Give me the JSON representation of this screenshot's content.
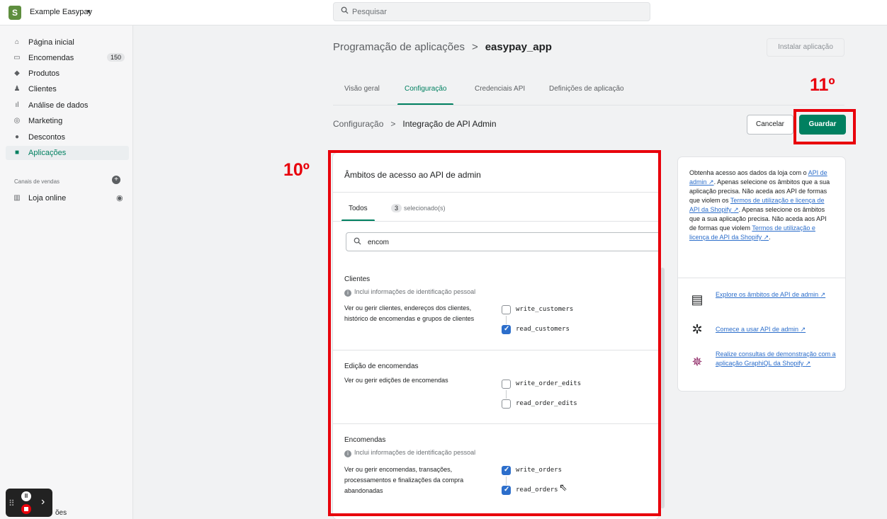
{
  "topbar": {
    "store_logo": "S",
    "store_name": "Example Easypay",
    "store_caret": "▾",
    "search_placeholder": "Pesquisar"
  },
  "sidebar": {
    "items": [
      {
        "label": "Página inicial",
        "icon": "home-icon",
        "glyph": "⌂"
      },
      {
        "label": "Encomendas",
        "icon": "orders-icon",
        "glyph": "▭",
        "badge": "150"
      },
      {
        "label": "Produtos",
        "icon": "tag-icon",
        "glyph": "◆"
      },
      {
        "label": "Clientes",
        "icon": "customers-icon",
        "glyph": "♟"
      },
      {
        "label": "Análise de dados",
        "icon": "analytics-icon",
        "glyph": "ıl"
      },
      {
        "label": "Marketing",
        "icon": "marketing-icon",
        "glyph": "◎"
      },
      {
        "label": "Descontos",
        "icon": "discount-icon",
        "glyph": "●"
      },
      {
        "label": "Aplicações",
        "icon": "apps-icon",
        "glyph": "■"
      }
    ],
    "channels_title": "Canais de vendas",
    "online_store": "Loja online"
  },
  "page": {
    "breadcrumb_parent": "Programação de aplicações",
    "breadcrumb_sep": ">",
    "breadcrumb_current": "easypay_app",
    "install_button": "Instalar aplicação",
    "tabs": [
      "Visão geral",
      "Configuração",
      "Credenciais API",
      "Definições de aplicação"
    ],
    "active_tab": "Configuração",
    "sub_breadcrumb_parent": "Configuração",
    "sub_breadcrumb_current": "Integração de API Admin",
    "cancel_button": "Cancelar",
    "save_button": "Guardar",
    "annotation_step_10": "10º",
    "annotation_step_11": "11º",
    "accent_color": "#008060",
    "annotation_color": "#e8000b"
  },
  "scopes_card": {
    "title": "Âmbitos de acesso ao API de admin",
    "tab_all": "Todos",
    "selected_count": "3",
    "selected_label": "selecionado(s)",
    "filter_value": "encom",
    "sections": [
      {
        "title": "Clientes",
        "note": "Inclui informações de identificação pessoal",
        "description": "Ver ou gerir clientes, endereços dos clientes, histórico de encomendas e grupos de clientes",
        "scopes": [
          {
            "name": "write_customers",
            "checked": false
          },
          {
            "name": "read_customers",
            "checked": true
          }
        ]
      },
      {
        "title": "Edição de encomendas",
        "note": "",
        "description": "Ver ou gerir edições de encomendas",
        "scopes": [
          {
            "name": "write_order_edits",
            "checked": false
          },
          {
            "name": "read_order_edits",
            "checked": false
          }
        ]
      },
      {
        "title": "Encomendas",
        "note": "Inclui informações de identificação pessoal",
        "description": "Ver ou gerir encomendas, transações, processamentos e finalizações da compra abandonadas",
        "scopes": [
          {
            "name": "write_orders",
            "checked": true
          },
          {
            "name": "read_orders",
            "checked": true
          }
        ]
      }
    ]
  },
  "info_card": {
    "text_1": "Obtenha acesso aos dados da loja com o ",
    "link_1": "API de admin",
    "text_2": ". Apenas selecione os âmbitos que a sua aplicação precisa. Não aceda aos API de formas que violem os ",
    "link_2": "Termos de utilização e licença de API da Shopify",
    "text_3": ". Apenas selecione os âmbitos que a sua aplicação precisa. Não aceda aos API de formas que violem ",
    "link_3": "Termos de utilização e licença de API da Shopify",
    "text_4": ".",
    "ext_glyph": "↗",
    "resources": [
      {
        "label": "Explore os âmbitos de API de admin",
        "icon": "document-icon",
        "glyph": "▤"
      },
      {
        "label": "Comece a usar API de admin",
        "icon": "gear-graph-icon",
        "glyph": "✲"
      },
      {
        "label": "Realize consultas de demonstração com a aplicação GraphiQL da Shopify",
        "icon": "graphiql-icon",
        "glyph": "✵"
      }
    ]
  },
  "recorder": {
    "pause_glyph": "II",
    "expand_glyph": "›",
    "partial_text": "ões"
  }
}
